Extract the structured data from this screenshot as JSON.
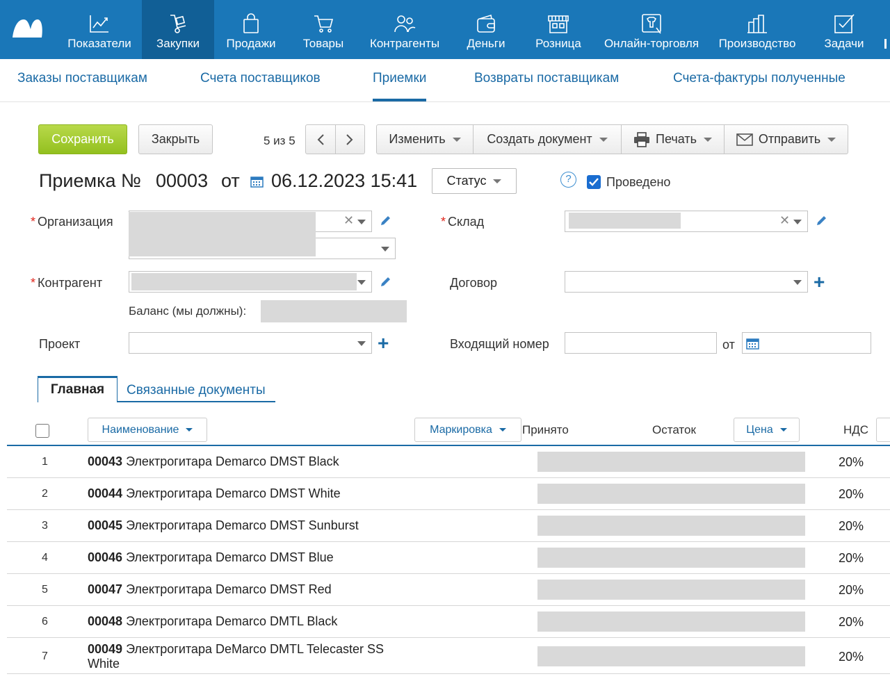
{
  "nav": {
    "items": [
      {
        "label": "Показатели",
        "icon": "chart-line-icon"
      },
      {
        "label": "Закупки",
        "icon": "dolly-cart-icon"
      },
      {
        "label": "Продажи",
        "icon": "shopping-bag-icon"
      },
      {
        "label": "Товары",
        "icon": "shopping-cart-icon"
      },
      {
        "label": "Контрагенты",
        "icon": "users-icon"
      },
      {
        "label": "Деньги",
        "icon": "wallet-icon"
      },
      {
        "label": "Розница",
        "icon": "store-icon"
      },
      {
        "label": "Онлайн-торговля",
        "icon": "online-store-icon"
      },
      {
        "label": "Производство",
        "icon": "factory-icon"
      },
      {
        "label": "Задачи",
        "icon": "task-check-icon"
      }
    ],
    "active_index": 1
  },
  "subnav": {
    "items": [
      "Заказы поставщикам",
      "Счета поставщиков",
      "Приемки",
      "Возвраты поставщикам",
      "Счета-фактуры полученные"
    ],
    "active_index": 2
  },
  "toolbar": {
    "save": "Сохранить",
    "close": "Закрыть",
    "counter": "5 из 5",
    "edit": "Изменить",
    "create_doc": "Создать документ",
    "print": "Печать",
    "send": "Отправить"
  },
  "header": {
    "title": "Приемка №",
    "number": "00003",
    "from": "от",
    "datetime": "06.12.2023 15:41",
    "status": "Статус",
    "help": "?",
    "posted_label": "Проведено",
    "posted": true
  },
  "form": {
    "organization_label": "Организация",
    "warehouse_label": "Склад",
    "counterparty_label": "Контрагент",
    "contract_label": "Договор",
    "balance_label": "Баланс (мы должны):",
    "project_label": "Проект",
    "incoming_number_label": "Входящий номер",
    "from_label": "от",
    "required_mark": "*"
  },
  "tabs": {
    "main": "Главная",
    "related": "Связанные документы"
  },
  "table": {
    "headers": {
      "name": "Наименование",
      "marking": "Маркировка",
      "accepted": "Принято",
      "remainder": "Остаток",
      "price": "Цена",
      "vat": "НДС"
    },
    "rows": [
      {
        "n": "1",
        "code": "00043",
        "name": "Электрогитара Demarco DMST Black",
        "vat": "20%"
      },
      {
        "n": "2",
        "code": "00044",
        "name": "Электрогитара Demarco DMST White",
        "vat": "20%"
      },
      {
        "n": "3",
        "code": "00045",
        "name": "Электрогитара Demarco DMST Sunburst",
        "vat": "20%"
      },
      {
        "n": "4",
        "code": "00046",
        "name": "Электрогитара Demarco DMST Blue",
        "vat": "20%"
      },
      {
        "n": "5",
        "code": "00047",
        "name": "Электрогитара Demarco DMST Red",
        "vat": "20%"
      },
      {
        "n": "6",
        "code": "00048",
        "name": "Электрогитара Demarco DMTL Black",
        "vat": "20%"
      },
      {
        "n": "7",
        "code": "00049",
        "name": "Электрогитара DeMarco DMTL Telecaster SS White",
        "vat": "20%"
      }
    ]
  },
  "colors": {
    "nav_bg": "#1a77b8",
    "nav_active": "#115f96",
    "link": "#1a6aa5",
    "save_green": "#93c01f",
    "required_red": "#e0251b"
  }
}
